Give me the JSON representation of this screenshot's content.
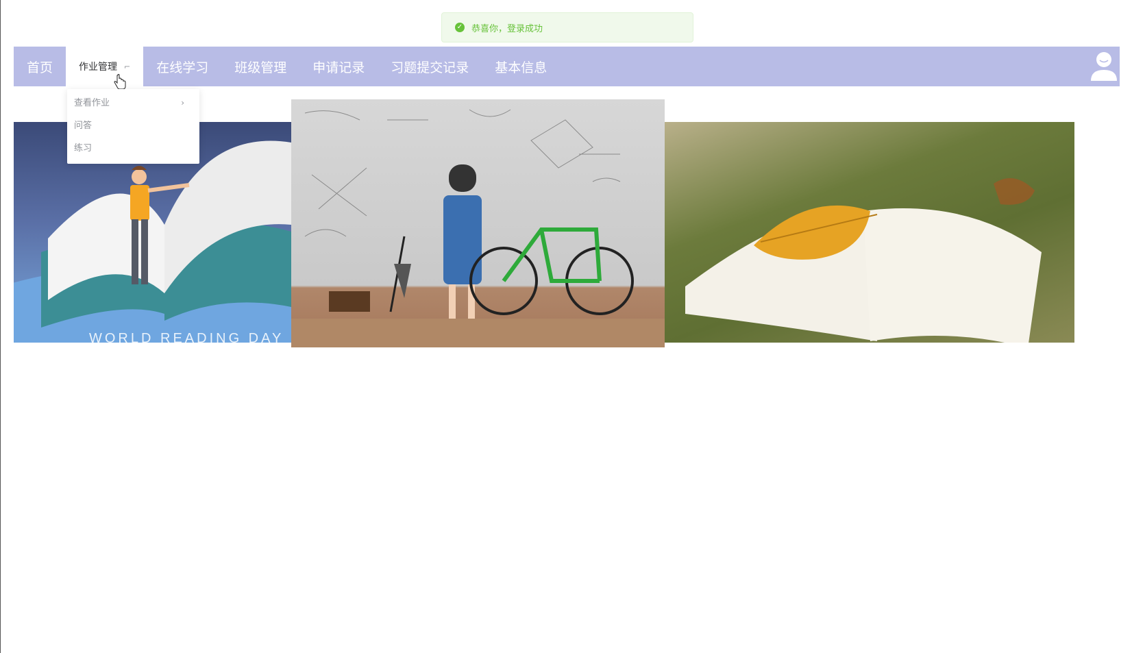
{
  "toast": {
    "message": "恭喜你，登录成功",
    "icon": "success-check-icon",
    "color": "#67c23a"
  },
  "nav": {
    "background": "#b8bce6",
    "items": [
      {
        "label": "首页"
      },
      {
        "label": "作业管理",
        "active": true
      },
      {
        "label": "在线学习"
      },
      {
        "label": "班级管理"
      },
      {
        "label": "申请记录"
      },
      {
        "label": "习题提交记录"
      },
      {
        "label": "基本信息"
      }
    ],
    "avatar_icon": "user-avatar-icon"
  },
  "dropdown": {
    "items": [
      {
        "label": "查看作业",
        "has_submenu": true
      },
      {
        "label": "问答"
      },
      {
        "label": "练习"
      }
    ]
  },
  "carousel": {
    "slides": [
      {
        "caption": "WORLD READING DAY"
      },
      {
        "caption": ""
      },
      {
        "caption": ""
      }
    ],
    "indicator_count": 5,
    "active_indicator": 4
  }
}
